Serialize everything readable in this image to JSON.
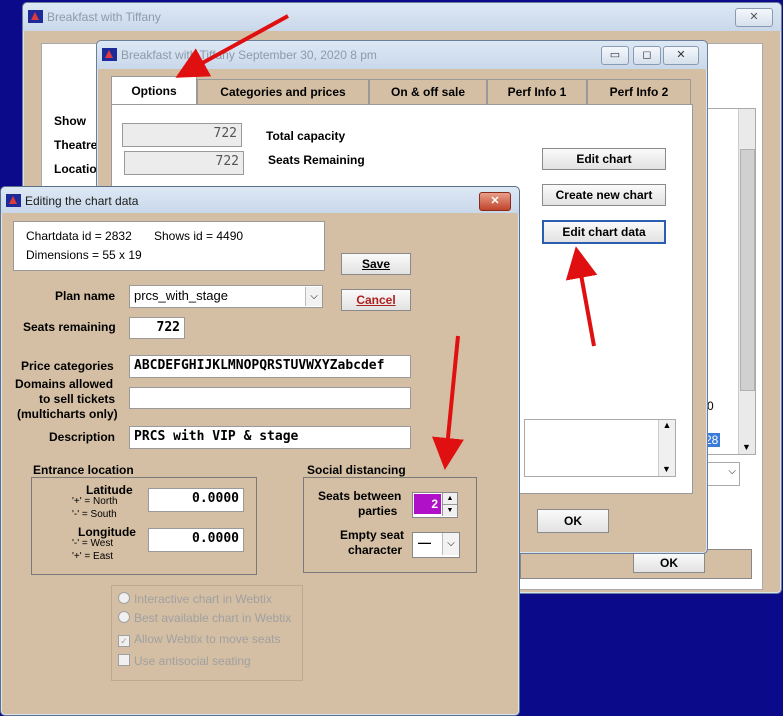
{
  "bg_window": {
    "title": "Breakfast with Tiffany",
    "close_label": "✕",
    "labels": [
      "Show",
      "Theatre",
      "Location"
    ],
    "list_partial_value": "0",
    "list_sel_partial": "28",
    "partial_ok": "OK"
  },
  "options_window": {
    "title": "Breakfast with Tiffany September 30, 2020 8 pm",
    "minimize_label": "▭",
    "maximize_label": "◻",
    "close_label": "✕",
    "tabs": [
      "Options",
      "Categories and prices",
      "On & off sale",
      "Perf Info 1",
      "Perf Info 2"
    ],
    "total_capacity_value": "722",
    "total_capacity_label": "Total capacity",
    "seats_remaining_value": "722",
    "seats_remaining_label": "Seats Remaining",
    "edit_chart": "Edit chart",
    "create_new_chart": "Create new chart",
    "edit_chart_data": "Edit chart data",
    "ok": "OK"
  },
  "chart_dialog": {
    "title": "Editing the chart data",
    "close_label": "✕",
    "info": {
      "chartdata_id": "Chartdata id = 2832",
      "shows_id": "Shows id = 4490",
      "dimensions": "Dimensions = 55 x 19"
    },
    "save": "Save",
    "cancel": "Cancel",
    "plan_name_label": "Plan name",
    "plan_name_value": "prcs_with_stage",
    "seats_remaining_label": "Seats remaining",
    "seats_remaining_value": "722",
    "price_categories_label": "Price categories",
    "price_categories_value": "ABCDEFGHIJKLMNOPQRSTUVWXYZabcdef",
    "domains_label_1": "Domains allowed",
    "domains_label_2": "to sell tickets",
    "domains_label_3": "(multicharts only)",
    "domains_value": "",
    "description_label": "Description",
    "description_value": "PRCS with VIP & stage",
    "entrance": {
      "title": "Entrance location",
      "latitude_label": "Latitude",
      "lat_hint_1": "'+' = North",
      "lat_hint_2": "'-' = South",
      "latitude_value": "0.0000",
      "longitude_label": "Longitude",
      "lon_hint_1": "'-' = West",
      "lon_hint_2": "'+' = East",
      "longitude_value": "0.0000"
    },
    "social": {
      "title": "Social distancing",
      "seats_between_1": "Seats between",
      "seats_between_2": "parties",
      "seats_between_value": "2",
      "empty_seat_1": "Empty seat",
      "empty_seat_2": "character",
      "empty_seat_value": "—"
    },
    "options": {
      "interactive": "Interactive chart in Webtix",
      "best_available": "Best available chart in Webtix",
      "allow_move": "Allow Webtix to move seats",
      "antisocial": "Use antisocial seating"
    }
  }
}
